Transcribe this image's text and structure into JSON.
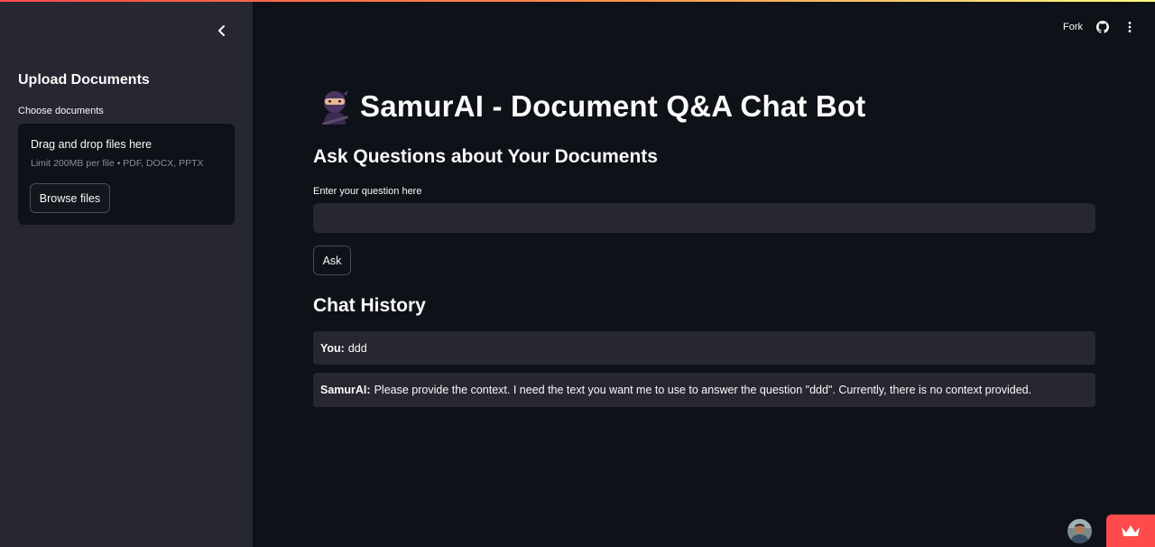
{
  "sidebar": {
    "heading": "Upload Documents",
    "choose_label": "Choose documents",
    "dropzone": {
      "title": "Drag and drop files here",
      "limit": "Limit 200MB per file • PDF, DOCX, PPTX",
      "browse_label": "Browse files"
    }
  },
  "header": {
    "fork_label": "Fork",
    "icons": [
      "github-icon",
      "more-vertical-icon"
    ]
  },
  "main": {
    "title_emoji": "ninja-emoji",
    "title": "SamurAI - Document Q&A Chat Bot",
    "subheading": "Ask Questions about Your Documents",
    "input_label": "Enter your question here",
    "input_value": "",
    "ask_label": "Ask",
    "history_heading": "Chat History",
    "messages": [
      {
        "speaker": "You:",
        "text": "ddd"
      },
      {
        "speaker": "SamurAI:",
        "text": "Please provide the context. I need the text you want me to use to answer the question \"ddd\". Currently, there is no context provided."
      }
    ]
  },
  "colors": {
    "background": "#0e1117",
    "sidebar": "#262730",
    "accent": "#ff4b4b",
    "text": "#fafafa"
  }
}
